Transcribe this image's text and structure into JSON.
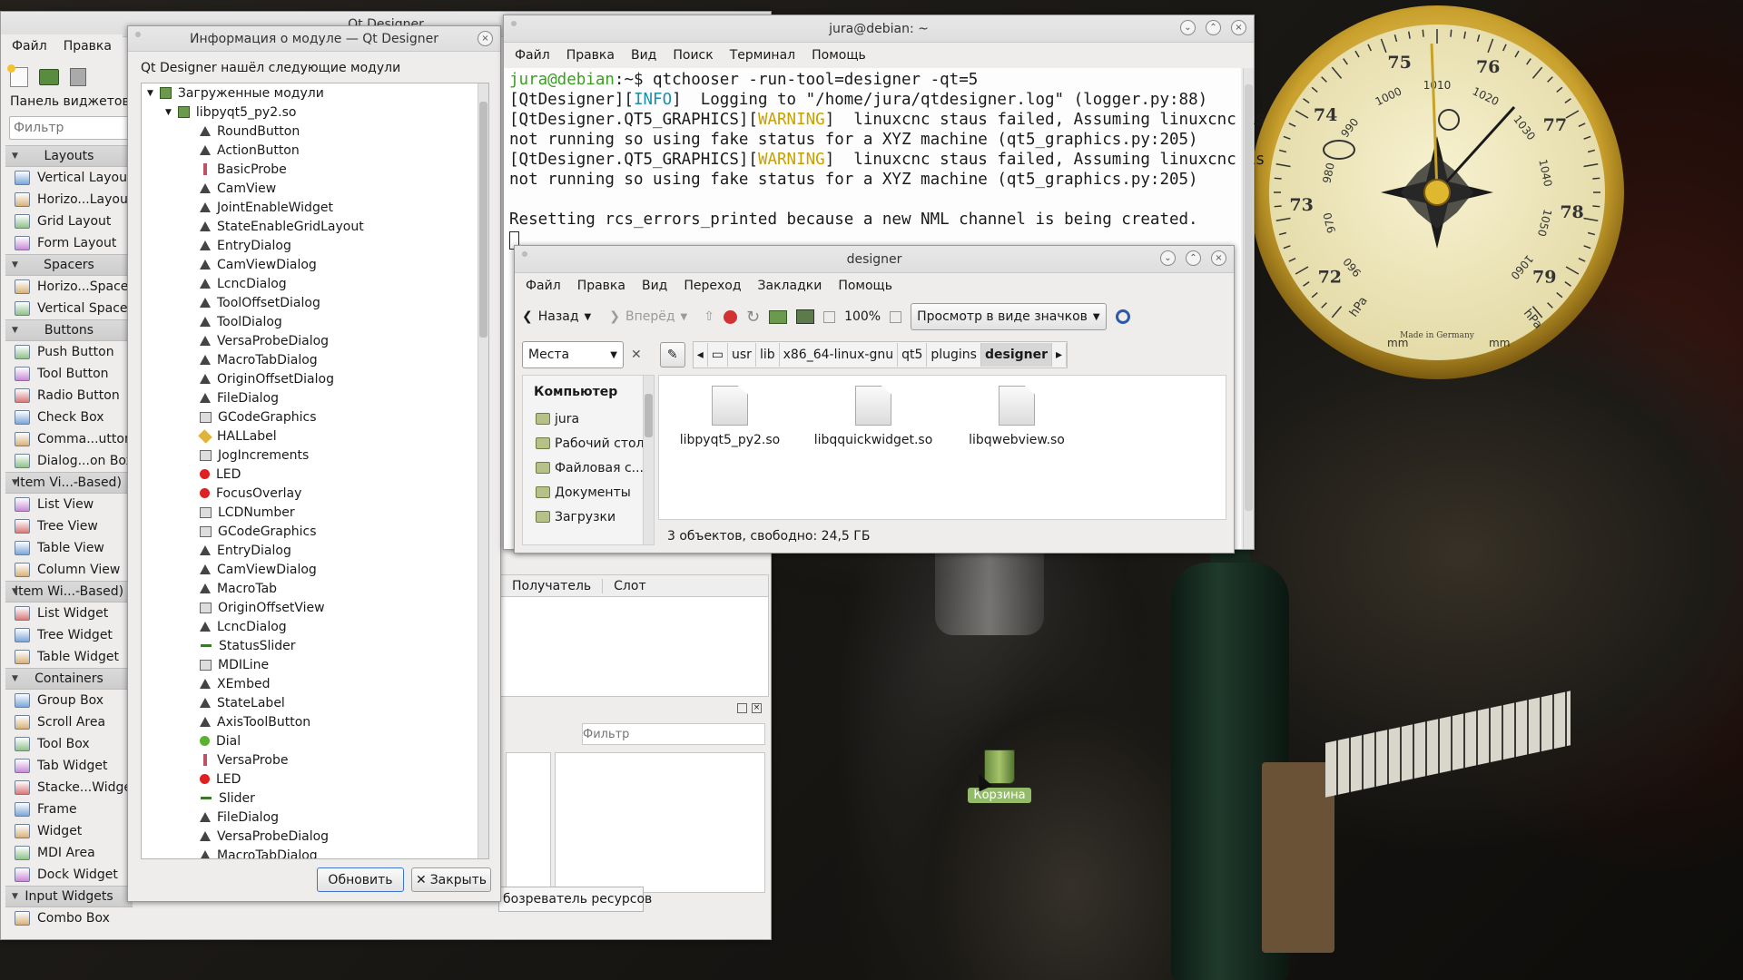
{
  "designer_main": {
    "title": "Qt Designer",
    "menus": [
      "Файл",
      "Правка"
    ],
    "widget_panel_title": "Панель виджетов",
    "filter_placeholder": "Фильтр",
    "categories": [
      {
        "name": "Layouts",
        "items": [
          "Vertical Layout",
          "Horizo...Layout",
          "Grid Layout",
          "Form Layout"
        ]
      },
      {
        "name": "Spacers",
        "items": [
          "Horizo...Spacer",
          "Vertical Spacer"
        ]
      },
      {
        "name": "Buttons",
        "items": [
          "Push Button",
          "Tool Button",
          "Radio Button",
          "Check Box",
          "Comma...utton",
          "Dialog...on Box"
        ]
      },
      {
        "name": "Item Vi...-Based)",
        "items": [
          "List View",
          "Tree View",
          "Table View",
          "Column View"
        ]
      },
      {
        "name": "Item Wi...-Based)",
        "items": [
          "List Widget",
          "Tree Widget",
          "Table Widget"
        ]
      },
      {
        "name": "Containers",
        "items": [
          "Group Box",
          "Scroll Area",
          "Tool Box",
          "Tab Widget",
          "Stacke...Widget",
          "Frame",
          "Widget",
          "MDI Area",
          "Dock Widget"
        ]
      },
      {
        "name": "Input Widgets",
        "items": [
          "Combo Box"
        ]
      }
    ],
    "signal_cols": [
      "Получатель",
      "Слот"
    ],
    "res_filter_placeholder": "Фильтр",
    "res_tab": "бозреватель ресурсов"
  },
  "plugin_dialog": {
    "title": "Информация о модуле — Qt Designer",
    "subtitle": "Qt Designer нашёл следующие модули",
    "root": "Загруженные модули",
    "plugin": "libpyqt5_py2.so",
    "widgets": [
      "RoundButton",
      "ActionButton",
      "BasicProbe",
      "CamView",
      "JointEnableWidget",
      "StateEnableGridLayout",
      "EntryDialog",
      "CamViewDialog",
      "LcncDialog",
      "ToolOffsetDialog",
      "ToolDialog",
      "VersaProbeDialog",
      "MacroTabDialog",
      "OriginOffsetDialog",
      "FileDialog",
      "GCodeGraphics",
      "HALLabel",
      "JogIncrements",
      "LED",
      "FocusOverlay",
      "LCDNumber",
      "GCodeGraphics",
      "EntryDialog",
      "CamViewDialog",
      "MacroTab",
      "OriginOffsetView",
      "LcncDialog",
      "StatusSlider",
      "MDILine",
      "XEmbed",
      "StateLabel",
      "AxisToolButton",
      "Dial",
      "VersaProbe",
      "LED",
      "Slider",
      "FileDialog",
      "VersaProbeDialog",
      "MacroTabDialog"
    ],
    "icons": [
      "tri",
      "tri",
      "probe",
      "tri",
      "tri",
      "tri",
      "tri",
      "tri",
      "tri",
      "tri",
      "tri",
      "tri",
      "tri",
      "tri",
      "tri",
      "box",
      "tag",
      "box",
      "red",
      "red",
      "box",
      "box",
      "tri",
      "tri",
      "tri",
      "box",
      "tri",
      "slider",
      "box",
      "tri",
      "tri",
      "tri",
      "green",
      "probe",
      "red",
      "slider",
      "tri",
      "tri",
      "tri"
    ],
    "refresh_btn": "Обновить",
    "close_btn": "Закрыть"
  },
  "terminal": {
    "title": "jura@debian: ~",
    "menus": [
      "Файл",
      "Правка",
      "Вид",
      "Поиск",
      "Терминал",
      "Помощь"
    ],
    "prompt_user": "jura@debian",
    "prompt_rest": ":~$ qtchooser -run-tool=designer -qt=5",
    "lines": [
      {
        "pre": "[QtDesigner][",
        "tag": "INFO",
        "post": "]  Logging to \"/home/jura/qtdesigner.log\" (logger.py:88)",
        "color": "#1a8fa8"
      },
      {
        "pre": "[QtDesigner.QT5_GRAPHICS][",
        "tag": "WARNING",
        "post": "]  linuxcnc staus failed, Assuming linuxcnc is",
        "color": "#c8a000"
      },
      {
        "pre": "not running so using fake status for a XYZ machine (qt5_graphics.py:205)",
        "tag": "",
        "post": "",
        "color": "#1b1b1b"
      },
      {
        "pre": "[QtDesigner.QT5_GRAPHICS][",
        "tag": "WARNING",
        "post": "]  linuxcnc staus failed, Assuming linuxcnc is",
        "color": "#c8a000"
      },
      {
        "pre": "not running so using fake status for a XYZ machine (qt5_graphics.py:205)",
        "tag": "",
        "post": "",
        "color": "#1b1b1b"
      },
      {
        "pre": "",
        "tag": "",
        "post": "",
        "color": "#1b1b1b"
      },
      {
        "pre": "Resetting rcs_errors_printed because a new NML channel is being created.",
        "tag": "",
        "post": "",
        "color": "#1b1b1b"
      }
    ]
  },
  "file_manager": {
    "title": "designer",
    "menus": [
      "Файл",
      "Правка",
      "Вид",
      "Переход",
      "Закладки",
      "Помощь"
    ],
    "back": "Назад",
    "forward": "Вперёд",
    "zoom": "100%",
    "view_mode": "Просмотр в виде значков",
    "places": "Места",
    "path": [
      "usr",
      "lib",
      "x86_64-linux-gnu",
      "qt5",
      "plugins",
      "designer"
    ],
    "sidebar_heading": "Компьютер",
    "sidebar_items": [
      "jura",
      "Рабочий стол",
      "Файловая с...",
      "Документы",
      "Загрузки"
    ],
    "files": [
      "libpyqt5_py2.so",
      "libqquickwidget.so",
      "libqwebview.so"
    ],
    "status": "3 объектов, свободно: 24,5 ГБ"
  },
  "barometer": {
    "numbers": [
      "72",
      "73",
      "74",
      "75",
      "76",
      "77",
      "78",
      "79"
    ],
    "inner": [
      "960",
      "970",
      "980",
      "990",
      "1000",
      "1010",
      "1020",
      "1030",
      "1040",
      "1050",
      "1060"
    ],
    "unit_left": "hPa",
    "unit_right": "hPa",
    "mm": "mm",
    "maker": "Made in Germany"
  },
  "desktop": {
    "trash_label": "Корзина"
  },
  "colors": {
    "prompt_green": "#3aa020",
    "prompt_blue": "#3465a4",
    "accent": "#2b6fd6"
  }
}
